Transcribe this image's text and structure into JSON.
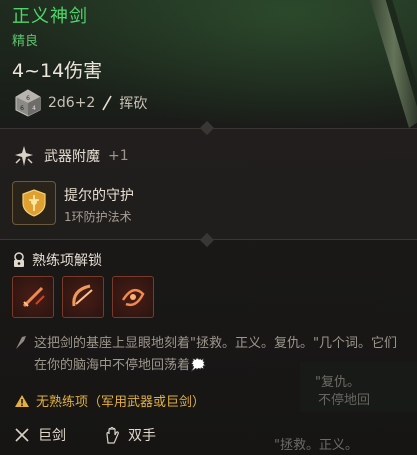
{
  "item": {
    "name": "正义神剑",
    "rarity": "精良",
    "damage": "4~14伤害",
    "dice": "2d6+2",
    "damage_type": "挥砍",
    "colors": {
      "name": "#4ed66a",
      "rarity": "#5fc06e",
      "warning": "#e2b040"
    }
  },
  "enchantment": {
    "label": "武器附魔",
    "count": "+1",
    "spell_name": "提尔的守护",
    "spell_level": "1环防护法术"
  },
  "proficiency": {
    "label": "熟练项解锁",
    "icons": [
      "slash-action-icon",
      "bow-action-icon",
      "flourish-action-icon"
    ]
  },
  "lore": {
    "text": "这把剑的基座上显眼地刻着\"拯救。正义。复仇。\"几个词。它们在你的脑海中不停地回荡着🗯️"
  },
  "overlay_text": {
    "line1": "\"复仇。",
    "line2": "不停地回",
    "line3": "\"拯救。正义。"
  },
  "warning": {
    "text": "无熟练项（军用武器或巨剑）"
  },
  "footer": {
    "type": "巨剑",
    "hands": "双手"
  }
}
